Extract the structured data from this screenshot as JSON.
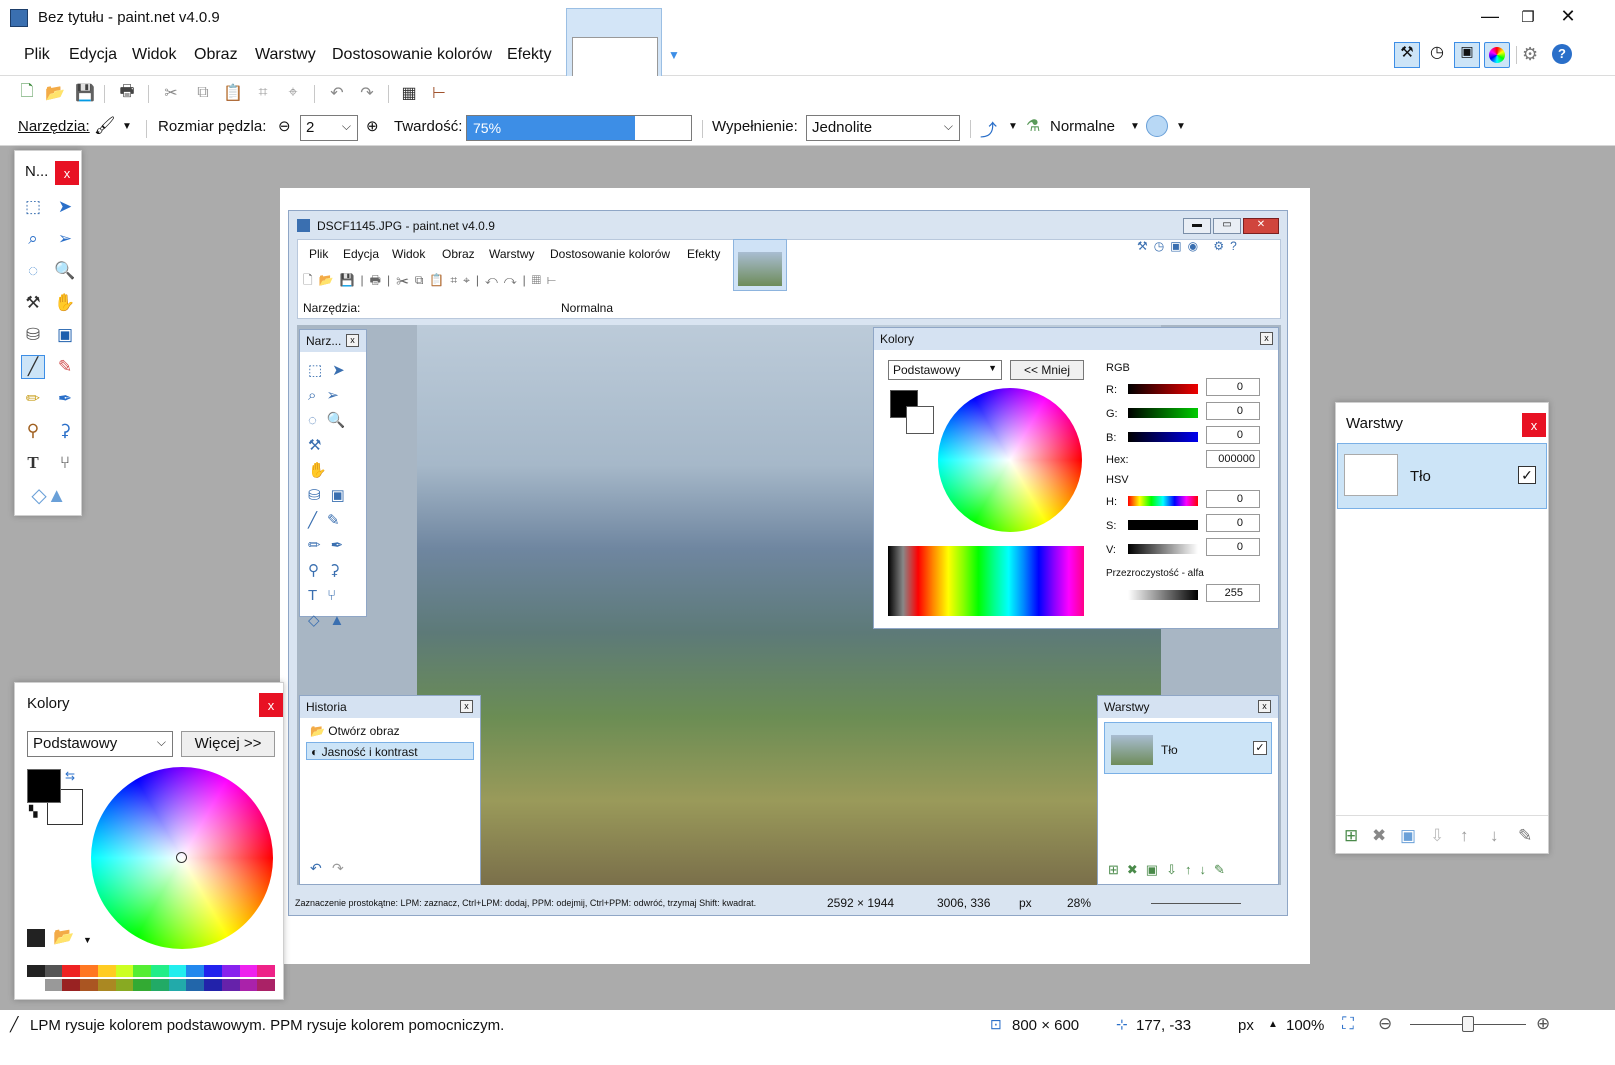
{
  "app": {
    "title": "Bez tytułu - paint.net v4.0.9"
  },
  "menu": [
    "Plik",
    "Edycja",
    "Widok",
    "Obraz",
    "Warstwy",
    "Dostosowanie kolorów",
    "Efekty"
  ],
  "toolbar2": {
    "tools_label": "Narzędzia:",
    "brush_size_label": "Rozmiar pędzla:",
    "brush_size_value": "2",
    "hardness_label": "Twardość:",
    "hardness_value": "75%",
    "hardness_fraction": 0.75,
    "fill_label": "Wypełnienie:",
    "fill_value": "Jednolite",
    "blend_value": "Normalne"
  },
  "tools_panel": {
    "title": "N...",
    "close": "x"
  },
  "colors_panel": {
    "title": "Kolory",
    "close": "x",
    "mode": "Podstawowy",
    "more_button": "Więcej >>"
  },
  "layers_panel": {
    "title": "Warstwy",
    "close": "x",
    "layer_name": "Tło"
  },
  "inner_window": {
    "title": "DSCF1145.JPG - paint.net v4.0.9",
    "menu": [
      "Plik",
      "Edycja",
      "Widok",
      "Obraz",
      "Warstwy",
      "Dostosowanie kolorów",
      "Efekty"
    ],
    "tools_label": "Narzędzia:",
    "blend_value": "Normalna",
    "tools_panel_title": "Narz...",
    "colors": {
      "title": "Kolory",
      "mode": "Podstawowy",
      "less_button": "<< Mniej",
      "rgb_label": "RGB",
      "r_label": "R:",
      "r_value": "0",
      "g_label": "G:",
      "g_value": "0",
      "b_label": "B:",
      "b_value": "0",
      "hex_label": "Hex:",
      "hex_value": "000000",
      "hsv_label": "HSV",
      "h_label": "H:",
      "h_value": "0",
      "s_label": "S:",
      "s_value": "0",
      "v_label": "V:",
      "v_value": "0",
      "alpha_label": "Przezroczystość - alfa",
      "alpha_value": "255"
    },
    "history": {
      "title": "Historia",
      "items": [
        "Otwórz obraz",
        "Jasność i kontrast"
      ]
    },
    "layers": {
      "title": "Warstwy",
      "layer_name": "Tło"
    },
    "status": {
      "hint": "Zaznaczenie prostokątne: LPM: zaznacz, Ctrl+LPM: dodaj, PPM: odejmij, Ctrl+PPM: odwróć, trzymaj Shift: kwadrat.",
      "size": "2592 × 1944",
      "cursor": "3006, 336",
      "unit": "px",
      "zoom": "28%"
    }
  },
  "status": {
    "hint": "LPM rysuje kolorem podstawowym. PPM rysuje kolorem pomocniczym.",
    "size": "800 × 600",
    "cursor": "177, -33",
    "unit": "px",
    "zoom": "100%"
  },
  "colors": {
    "accent": "#3d8ee6",
    "selection": "#cce4f7",
    "close_red": "#e81123"
  }
}
